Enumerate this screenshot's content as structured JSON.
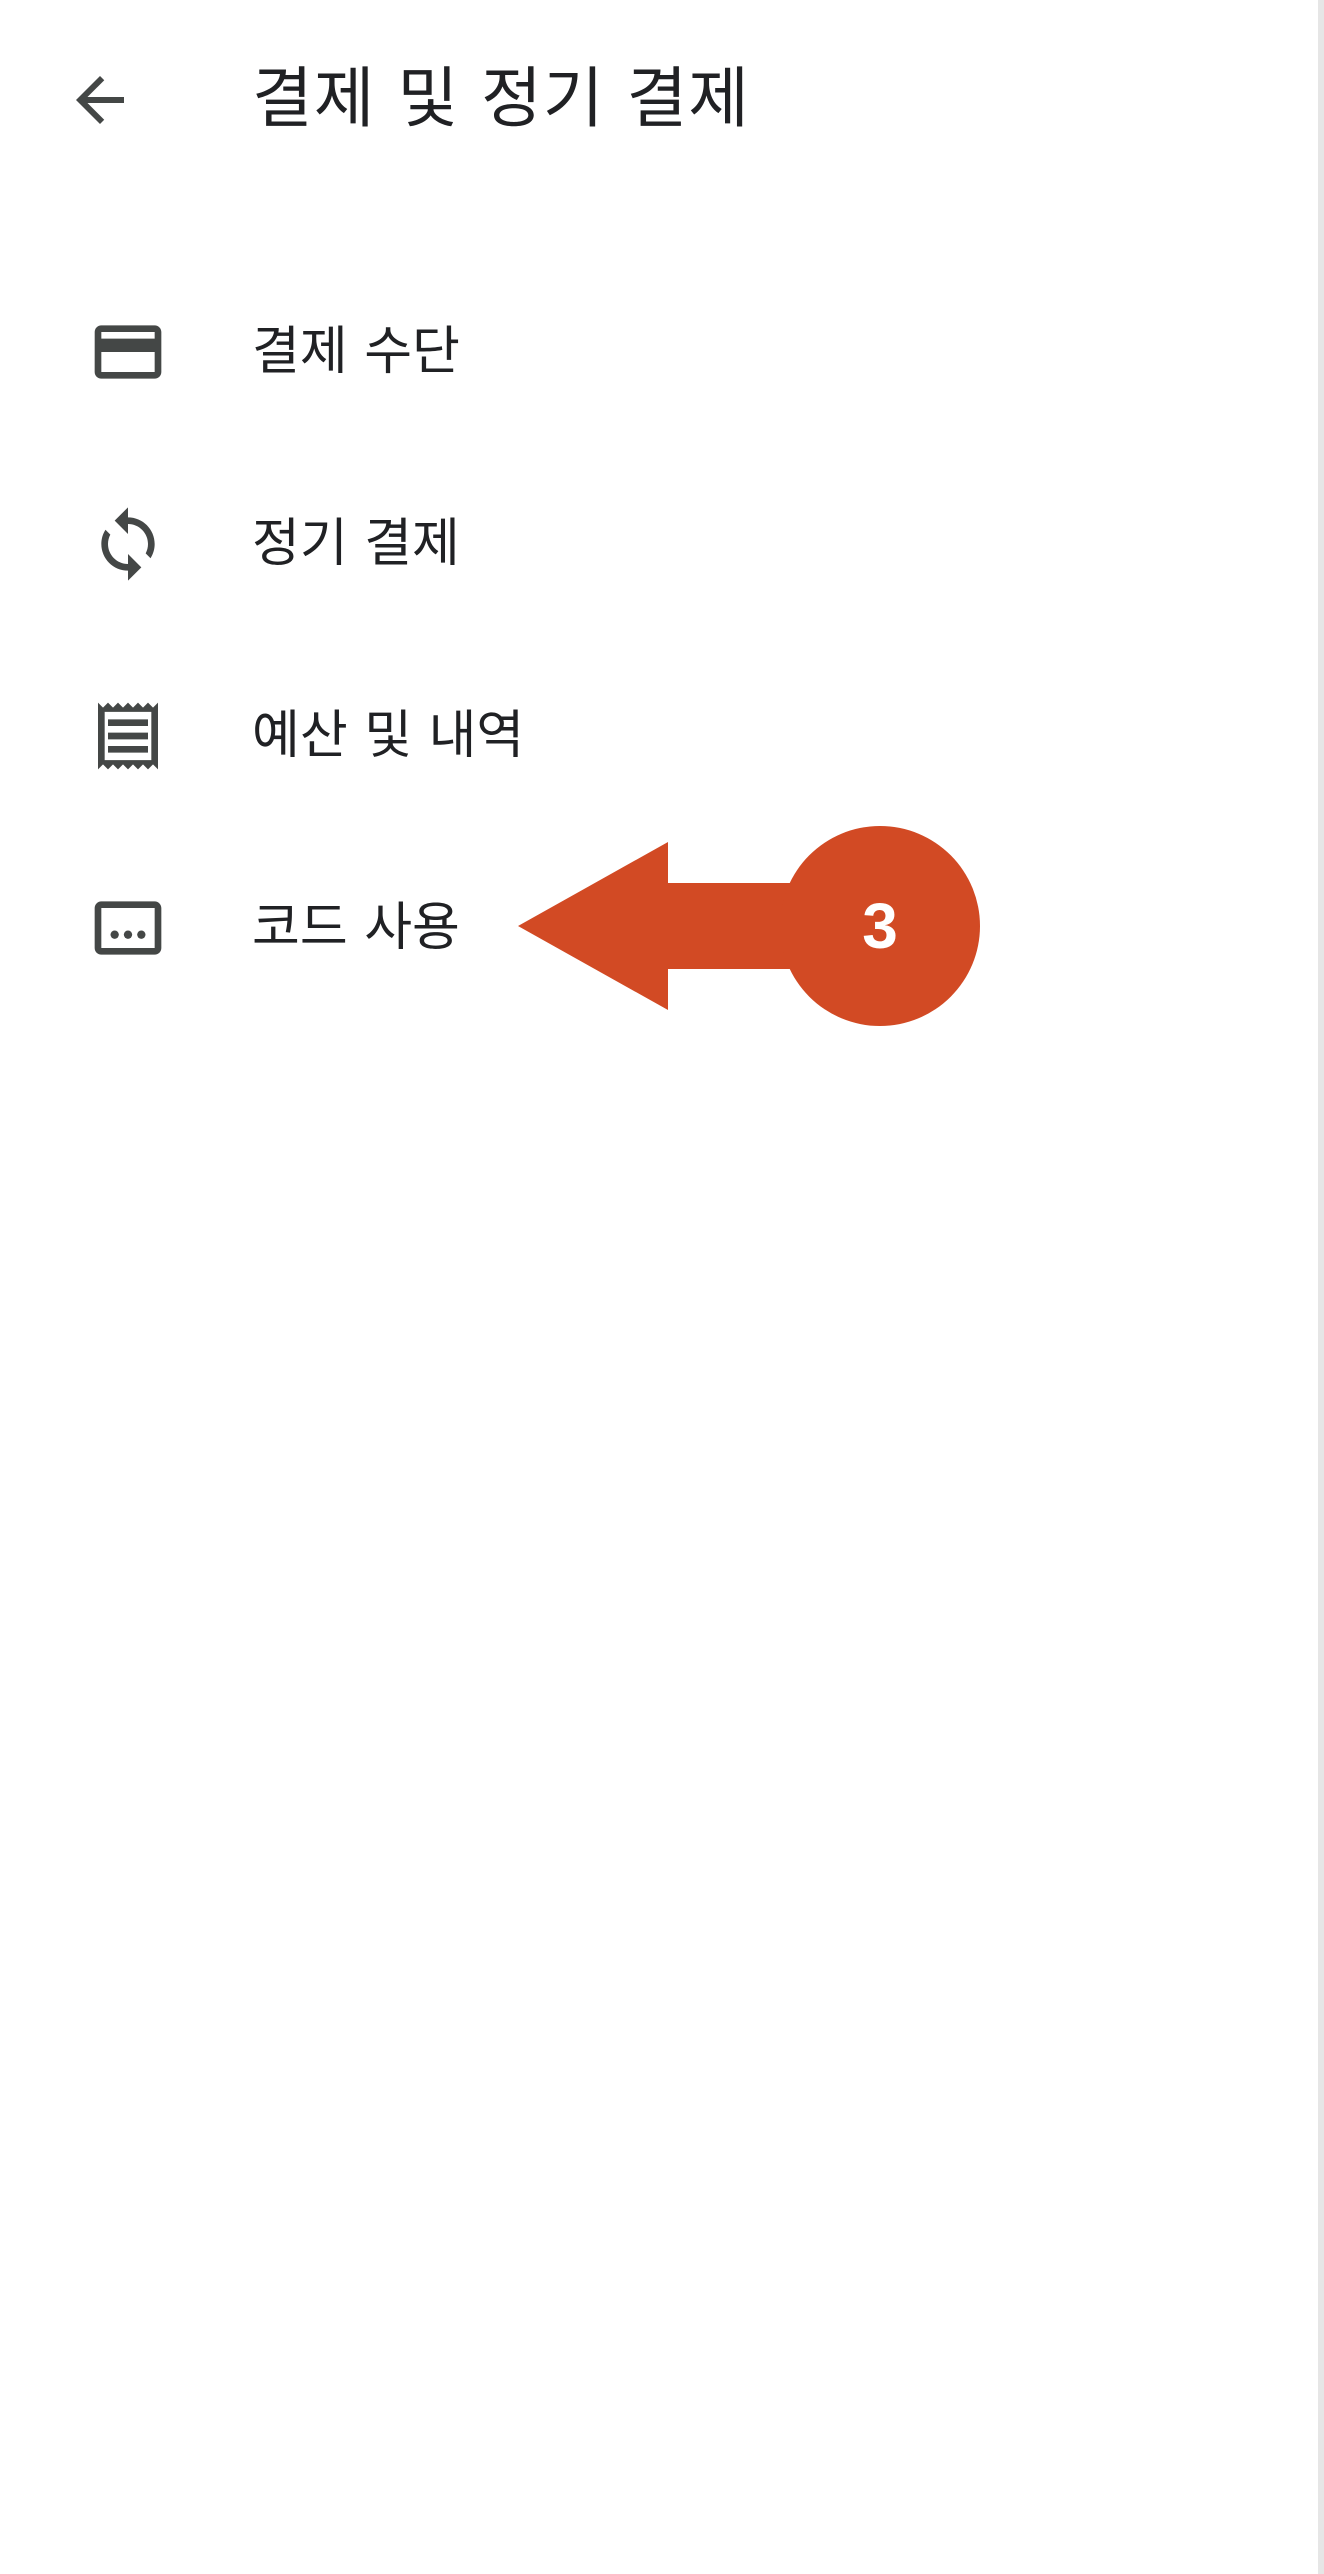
{
  "header": {
    "title": "결제 및 정기 결제",
    "back_icon": "arrow-back-icon"
  },
  "menu": {
    "items": [
      {
        "label": "결제 수단",
        "icon": "credit-card-icon"
      },
      {
        "label": "정기 결제",
        "icon": "sync-icon"
      },
      {
        "label": "예산 및 내역",
        "icon": "receipt-icon"
      },
      {
        "label": "코드 사용",
        "icon": "redeem-code-icon"
      }
    ]
  },
  "annotation": {
    "step_number": "3",
    "color": "#D24A24"
  },
  "colors": {
    "icon": "#444746",
    "text": "#202124",
    "background": "#FFFFFF"
  }
}
